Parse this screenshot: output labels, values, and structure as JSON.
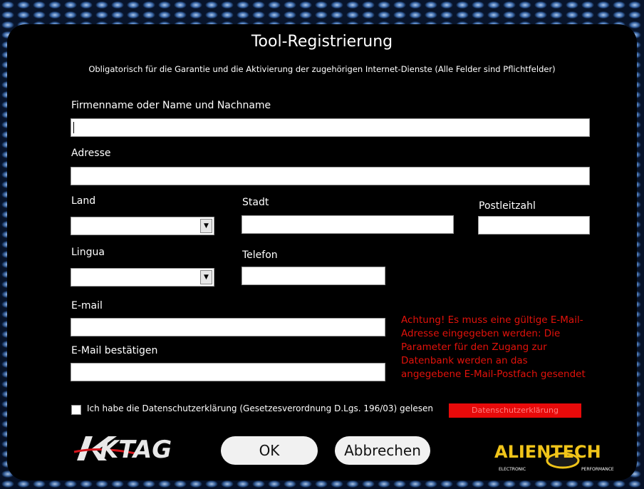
{
  "dialog": {
    "title": "Tool-Registrierung",
    "subtitle": "Obligatorisch für die Garantie und die Aktivierung der zugehörigen Internet-Dienste (Alle Felder sind Pflichtfelder)"
  },
  "form": {
    "company_label": "Firmenname oder Name und Nachname",
    "company_value": "",
    "address_label": "Adresse",
    "address_value": "",
    "country_label": "Land",
    "country_value": "",
    "city_label": "Stadt",
    "city_value": "",
    "zip_label": "Postleitzahl",
    "zip_value": "",
    "language_label": "Lingua",
    "language_value": "",
    "phone_label": "Telefon",
    "phone_value": "",
    "email_label": "E-mail",
    "email_value": "",
    "email_confirm_label": "E-Mail bestätigen",
    "email_confirm_value": ""
  },
  "warning": "Achtung! Es muss eine gültige E-Mail-Adresse eingegeben werden: Die Parameter für den Zugang zur Datenbank werden an das angegebene E-Mail-Postfach gesendet",
  "privacy": {
    "checkbox_label": "Ich habe die Datenschutzerklärung (Gesetzesverordnung D.Lgs. 196/03) gelesen",
    "button_label": "Datenschutzerklärung",
    "checked": false
  },
  "buttons": {
    "ok": "OK",
    "cancel": "Abbrechen"
  },
  "logos": {
    "left": "KTAG",
    "right_main": "ALIENTECH",
    "right_sub_left": "ELECTRONIC",
    "right_sub_right": "PERFORMANCE"
  },
  "colors": {
    "warning": "#e3120b",
    "privacy_button": "#e80a0a",
    "panel": "#000000"
  }
}
